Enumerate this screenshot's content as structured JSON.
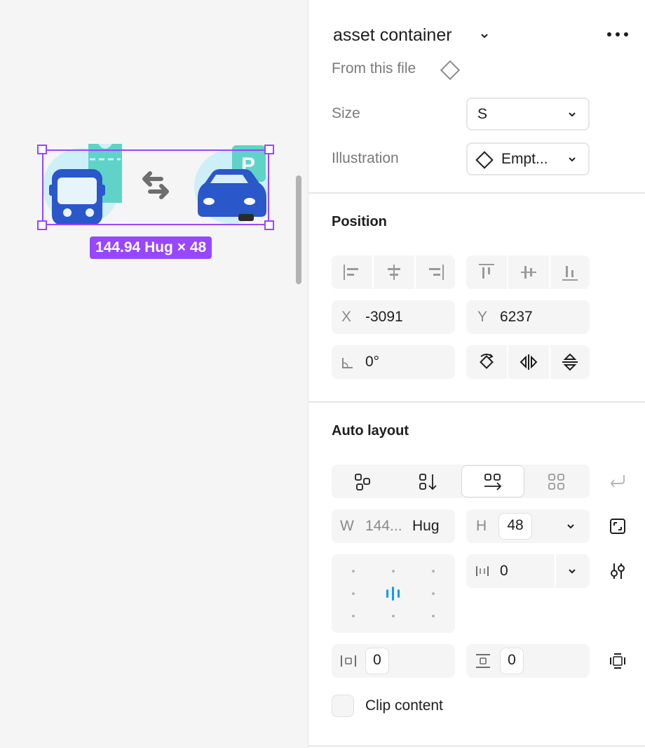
{
  "canvas": {
    "size_badge": "144.94 Hug × 48"
  },
  "header": {
    "title": "asset container",
    "source": "From this file"
  },
  "properties": {
    "size_label": "Size",
    "size_value": "S",
    "illustration_label": "Illustration",
    "illustration_value": "Empt..."
  },
  "position": {
    "title": "Position",
    "x_label": "X",
    "x_value": "-3091",
    "y_label": "Y",
    "y_value": "6237",
    "rotation_value": "0°"
  },
  "auto_layout": {
    "title": "Auto layout",
    "w_label": "W",
    "w_value": "144...",
    "w_mode": "Hug",
    "h_label": "H",
    "h_value": "48",
    "gap_value": "0",
    "padding_h_value": "0",
    "padding_v_value": "0",
    "clip_label": "Clip content"
  },
  "colors": {
    "accent": "#9747ff",
    "blue": "#0d99ff"
  }
}
